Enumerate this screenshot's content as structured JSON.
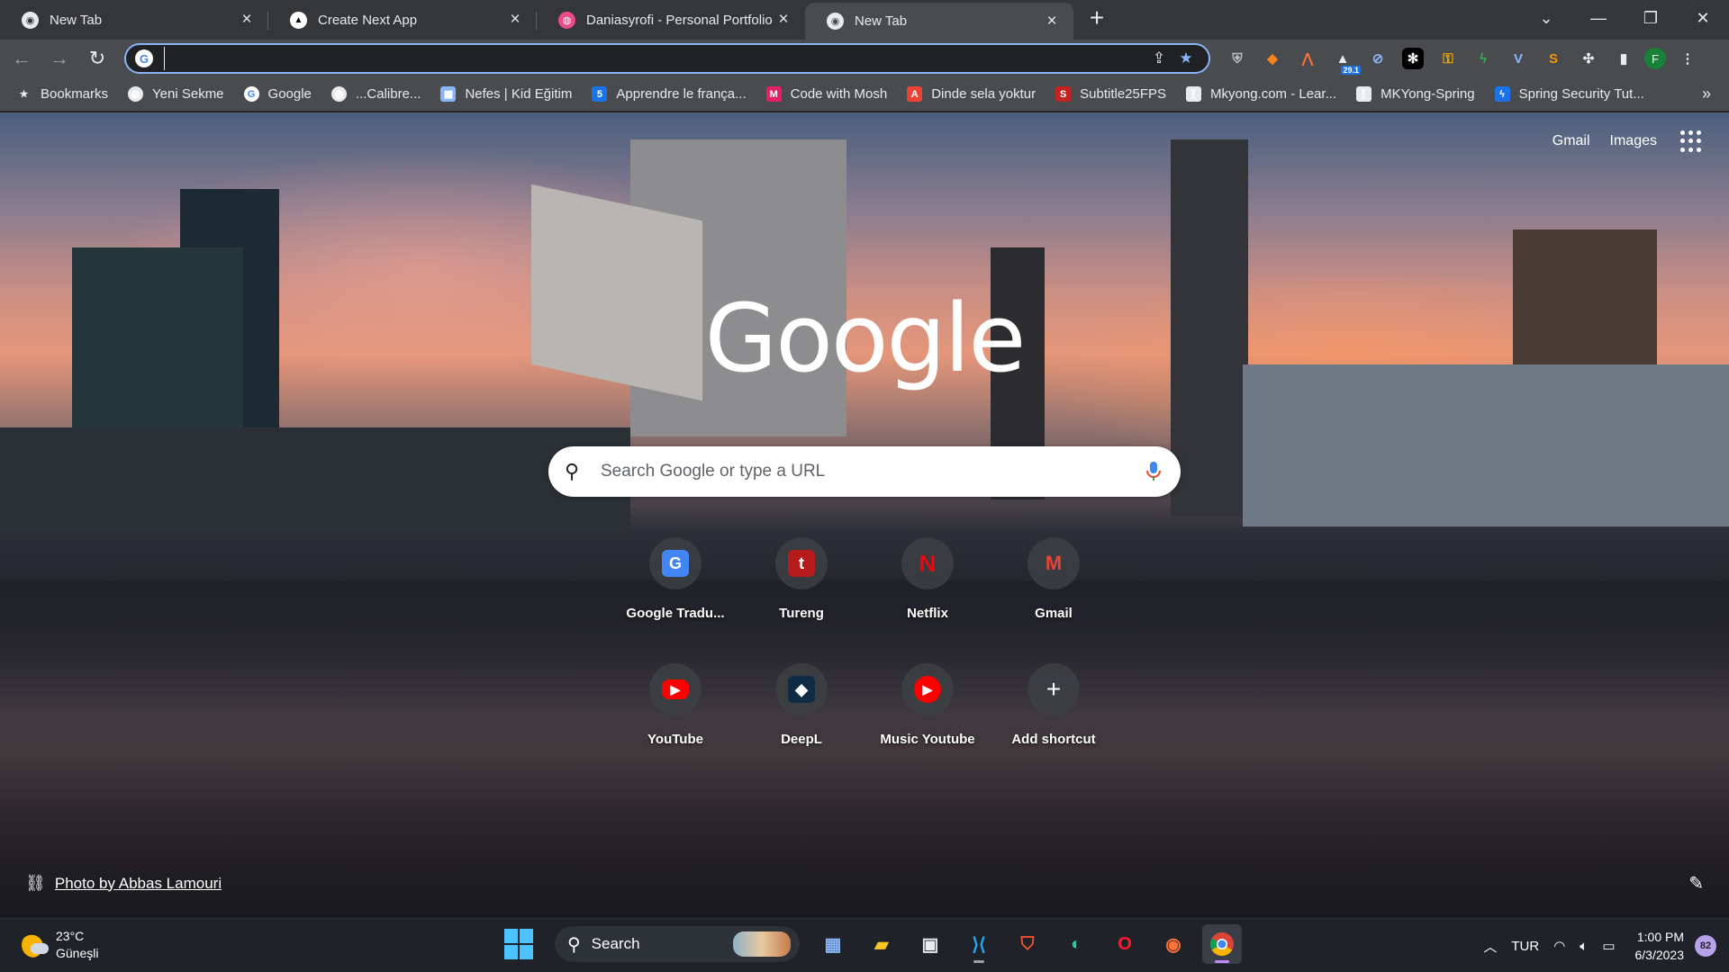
{
  "tabs": [
    {
      "title": "New Tab",
      "favicon": "chrome-icon",
      "active": false
    },
    {
      "title": "Create Next App",
      "favicon": "triangle-icon",
      "active": false
    },
    {
      "title": "Daniasyrofi - Personal Portfolio L",
      "favicon": "dribbble-icon",
      "active": false
    },
    {
      "title": "New Tab",
      "favicon": "chrome-icon",
      "active": true
    }
  ],
  "omnibox": {
    "value": "",
    "placeholder": ""
  },
  "bookmarks": [
    {
      "label": "Bookmarks",
      "icon": "star-icon",
      "color": "#e8eaed"
    },
    {
      "label": "Yeni Sekme",
      "icon": "globe-icon",
      "color": "#e8eaed"
    },
    {
      "label": "Google",
      "icon": "google-icon",
      "color": "#ffffff"
    },
    {
      "label": "...Calibre...",
      "icon": "globe-icon",
      "color": "#e8eaed"
    },
    {
      "label": "Nefes | Kid Eğitim",
      "icon": "image-icon",
      "color": "#8ab4f8"
    },
    {
      "label": "Apprendre le frança...",
      "icon": "tv5-icon",
      "color": "#1a73e8"
    },
    {
      "label": "Code with Mosh",
      "icon": "mosh-icon",
      "color": "#e91e63"
    },
    {
      "label": "Dinde sela yoktur",
      "icon": "a-icon",
      "color": "#ea4335"
    },
    {
      "label": "Subtitle25FPS",
      "icon": "sub-icon",
      "color": "#c5221f"
    },
    {
      "label": "Mkyong.com - Lear...",
      "icon": "bracket-icon",
      "color": "#e8eaed"
    },
    {
      "label": "MKYong-Spring",
      "icon": "bracket-icon",
      "color": "#e8eaed"
    },
    {
      "label": "Spring Security Tut...",
      "icon": "bolt-icon",
      "color": "#1a73e8"
    }
  ],
  "ntp": {
    "top_links": {
      "gmail": "Gmail",
      "images": "Images"
    },
    "logo": "Google",
    "search_placeholder": "Search Google or type a URL",
    "shortcuts": [
      {
        "label": "Google Tradu...",
        "icon": "google-translate-icon",
        "glyph": "G",
        "bg": "#4285f4"
      },
      {
        "label": "Tureng",
        "icon": "tureng-icon",
        "glyph": "t",
        "bg": "#b71c1c"
      },
      {
        "label": "Netflix",
        "icon": "netflix-icon",
        "glyph": "N",
        "bg": "transparent"
      },
      {
        "label": "Gmail",
        "icon": "gmail-icon",
        "glyph": "M",
        "bg": "transparent"
      },
      {
        "label": "YouTube",
        "icon": "youtube-icon",
        "glyph": "▶",
        "bg": "#ff0000"
      },
      {
        "label": "DeepL",
        "icon": "deepl-icon",
        "glyph": "◆",
        "bg": "#0f2b46"
      },
      {
        "label": "Music Youtube",
        "icon": "youtube-music-icon",
        "glyph": "▶",
        "bg": "#ff0000"
      },
      {
        "label": "Add shortcut",
        "icon": "plus-icon",
        "glyph": "+",
        "bg": "transparent"
      }
    ],
    "photo_credit": "Photo by Abbas Lamouri"
  },
  "extensions": {
    "badge": "29.1",
    "profile_initial": "F"
  },
  "taskbar": {
    "weather_temp": "23°C",
    "weather_desc": "Güneşli",
    "search_label": "Search",
    "language": "TUR",
    "time": "1:00 PM",
    "date": "6/3/2023",
    "notification_count": "82"
  }
}
